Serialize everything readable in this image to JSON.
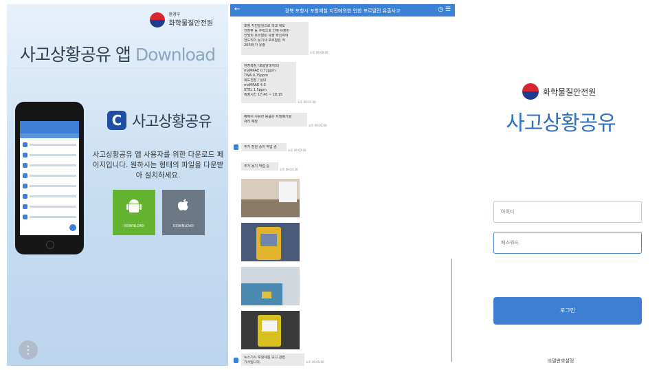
{
  "download_page": {
    "brand_ministry": "환경부",
    "brand_name": "화학물질안전원",
    "title_main": "사고상황공유 앱",
    "title_download": "Download",
    "app_icon_letter": "C",
    "app_name": "사고상황공유",
    "description": "사고상황공유 앱 사용자를 위한 다운로드 페이지입니다. 원하시는 형태의 파일을 다운받아 설치하세요.",
    "android_label": "DOWNLOAD",
    "apple_label": "DOWNLOAD",
    "colors": {
      "android": "#64b431",
      "apple": "#6b7784",
      "app_icon": "#1f4fa3"
    }
  },
  "chat": {
    "title": "경북 포항시 포항제철 지진에의한 인한 포르말린 유출사고",
    "messages": [
      {
        "lines": [
          "포항 지진발생으로 학교 복도",
          "천장판 등 추락으로 인해 유출된",
          "인명피 포르말린 유출 확인하여",
          "전도되어 용기내 포르말린 약",
          "20리터가 유출"
        ],
        "time": "오후 09:00:00"
      },
      {
        "lines": [
          "현장측정 (포름알데히드)",
          "maMRAE 0.72ppm",
          "TWA 0.75ppm",
          "복도천장 / 실내",
          "maMRAE 4.0",
          "STEL 1.5ppm",
          "측정시간 17:40 ~ 18:15"
        ],
        "time": "오후 09:01:00"
      },
      {
        "lines": [
          "병해서 사용한 용품은 지정폐기물",
          "처리 예정"
        ],
        "time": "오후 09:02:00"
      },
      {
        "lines": [
          "추가 점검 중이 작업 중"
        ],
        "time": "오후 09:03:00"
      },
      {
        "lines": [
          "추가 용기 작업 중"
        ],
        "time": "오후 09:03:20"
      },
      {
        "lines": [
          "뉴스기사 포항제철 보고 관련",
          "기사입니다."
        ],
        "time": "오후 09:05:00"
      }
    ],
    "photos": [
      {
        "name": "photo-1",
        "colors": [
          "#8a7a66",
          "#d8cdbd"
        ]
      },
      {
        "name": "photo-2",
        "colors": [
          "#e1b42b",
          "#4a5b79"
        ]
      },
      {
        "name": "photo-3",
        "colors": [
          "#4b89b1",
          "#cfd7dc"
        ]
      },
      {
        "name": "photo-4",
        "colors": [
          "#d9c021",
          "#3a3a3a"
        ]
      }
    ]
  },
  "login": {
    "brand_name": "화학물질안전원",
    "app_title": "사고상황공유",
    "id_placeholder": "아이디",
    "password_placeholder": "패스워드",
    "login_label": "로그인",
    "reset_label": "비밀번호설정",
    "accent": "#3e7fd2"
  }
}
